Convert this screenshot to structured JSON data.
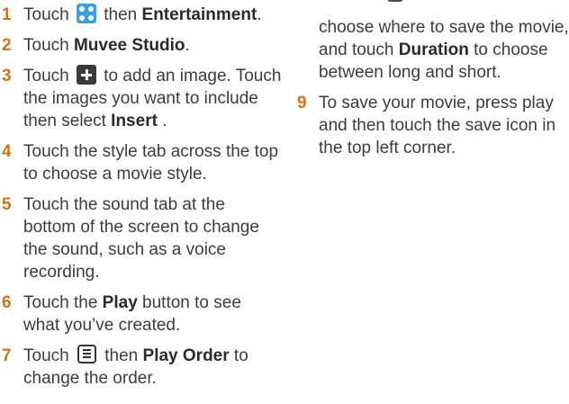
{
  "left_steps": [
    {
      "num": "1",
      "lines": [
        [
          {
            "t": "Touch "
          },
          {
            "icon": "apps-icon"
          },
          {
            "t": " then "
          },
          {
            "b": "Entertainment"
          },
          {
            "t": "."
          }
        ]
      ]
    },
    {
      "num": "2",
      "lines": [
        [
          {
            "t": "Touch "
          },
          {
            "b": "Muvee Studio"
          },
          {
            "t": "."
          }
        ]
      ]
    },
    {
      "num": "3",
      "lines": [
        [
          {
            "t": "Touch "
          },
          {
            "icon": "plus-icon"
          },
          {
            "t": " to add an image. Touch"
          }
        ],
        [
          {
            "t": "the images you want to include"
          }
        ],
        [
          {
            "t": "then select "
          },
          {
            "b": "Insert"
          },
          {
            "t": " ."
          }
        ]
      ]
    },
    {
      "num": "4",
      "lines": [
        [
          {
            "t": "Touch the style tab across the top"
          }
        ],
        [
          {
            "t": "to choose a movie style."
          }
        ]
      ]
    },
    {
      "num": "5",
      "lines": [
        [
          {
            "t": "Touch the sound tab at the"
          }
        ],
        [
          {
            "t": "bottom of the screen to change"
          }
        ],
        [
          {
            "t": "the sound, such as a voice"
          }
        ],
        [
          {
            "t": "recording."
          }
        ]
      ]
    },
    {
      "num": "6",
      "lines": [
        [
          {
            "t": "Touch the "
          },
          {
            "b": "Play"
          },
          {
            "t": " button to see"
          }
        ],
        [
          {
            "t": "what you’ve created."
          }
        ]
      ]
    },
    {
      "num": "7",
      "lines": [
        [
          {
            "t": "Touch "
          },
          {
            "icon": "menu-icon"
          },
          {
            "t": " then "
          },
          {
            "b": "Play Order"
          },
          {
            "t": " to"
          }
        ],
        [
          {
            "t": "change the order."
          }
        ]
      ]
    }
  ],
  "right_continuation": {
    "lines": [
      [
        {
          "t": "choose where to save the movie,"
        }
      ],
      [
        {
          "t": "and touch "
        },
        {
          "b": "Duration"
        },
        {
          "t": " to choose"
        }
      ],
      [
        {
          "t": "between long and short."
        }
      ]
    ]
  },
  "right_steps": [
    {
      "num": "9",
      "lines": [
        [
          {
            "t": "To save your movie, press play"
          }
        ],
        [
          {
            "t": "and then touch the save icon in"
          }
        ],
        [
          {
            "t": "the top left corner."
          }
        ]
      ]
    }
  ]
}
